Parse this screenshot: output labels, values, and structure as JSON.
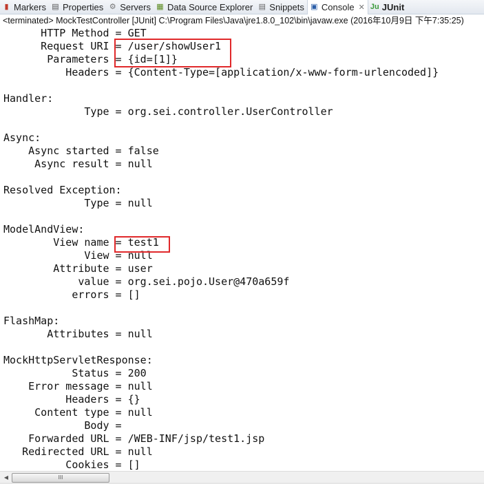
{
  "tabs": [
    {
      "label": "Markers",
      "icon": "markers-icon",
      "glyph": "▮",
      "color": "#c0392b"
    },
    {
      "label": "Properties",
      "icon": "properties-icon",
      "glyph": "▤",
      "color": "#555"
    },
    {
      "label": "Servers",
      "icon": "servers-icon",
      "glyph": "⚙",
      "color": "#777"
    },
    {
      "label": "Data Source Explorer",
      "icon": "database-icon",
      "glyph": "▦",
      "color": "#5a8a1e"
    },
    {
      "label": "Snippets",
      "icon": "snippets-icon",
      "glyph": "▤",
      "color": "#666"
    },
    {
      "label": "Console",
      "icon": "console-icon",
      "glyph": "▣",
      "color": "#2b5ea8",
      "active": true,
      "close": "✕"
    },
    {
      "label": "JUnit",
      "icon": "junit-icon",
      "glyph": "Ju",
      "color": "#3a9a3a",
      "bold": true
    }
  ],
  "status": "<terminated> MockTestController [JUnit] C:\\Program Files\\Java\\jre1.8.0_102\\bin\\javaw.exe (2016年10月9日 下午7:35:25)",
  "console_lines": [
    "      HTTP Method = GET",
    "      Request URI = /user/showUser1",
    "       Parameters = {id=[1]}",
    "          Headers = {Content-Type=[application/x-www-form-urlencoded]}",
    "",
    "Handler:",
    "             Type = org.sei.controller.UserController",
    "",
    "Async:",
    "    Async started = false",
    "     Async result = null",
    "",
    "Resolved Exception:",
    "             Type = null",
    "",
    "ModelAndView:",
    "        View name = test1",
    "             View = null",
    "        Attribute = user",
    "            value = org.sei.pojo.User@470a659f",
    "           errors = []",
    "",
    "FlashMap:",
    "       Attributes = null",
    "",
    "MockHttpServletResponse:",
    "           Status = 200",
    "    Error message = null",
    "          Headers = {}",
    "     Content type = null",
    "             Body = ",
    "    Forwarded URL = /WEB-INF/jsp/test1.jsp",
    "   Redirected URL = null",
    "          Cookies = []"
  ],
  "highlight_color": "#e0282a",
  "scrollbar": {
    "left_arrow": "◀",
    "grip": "III"
  }
}
